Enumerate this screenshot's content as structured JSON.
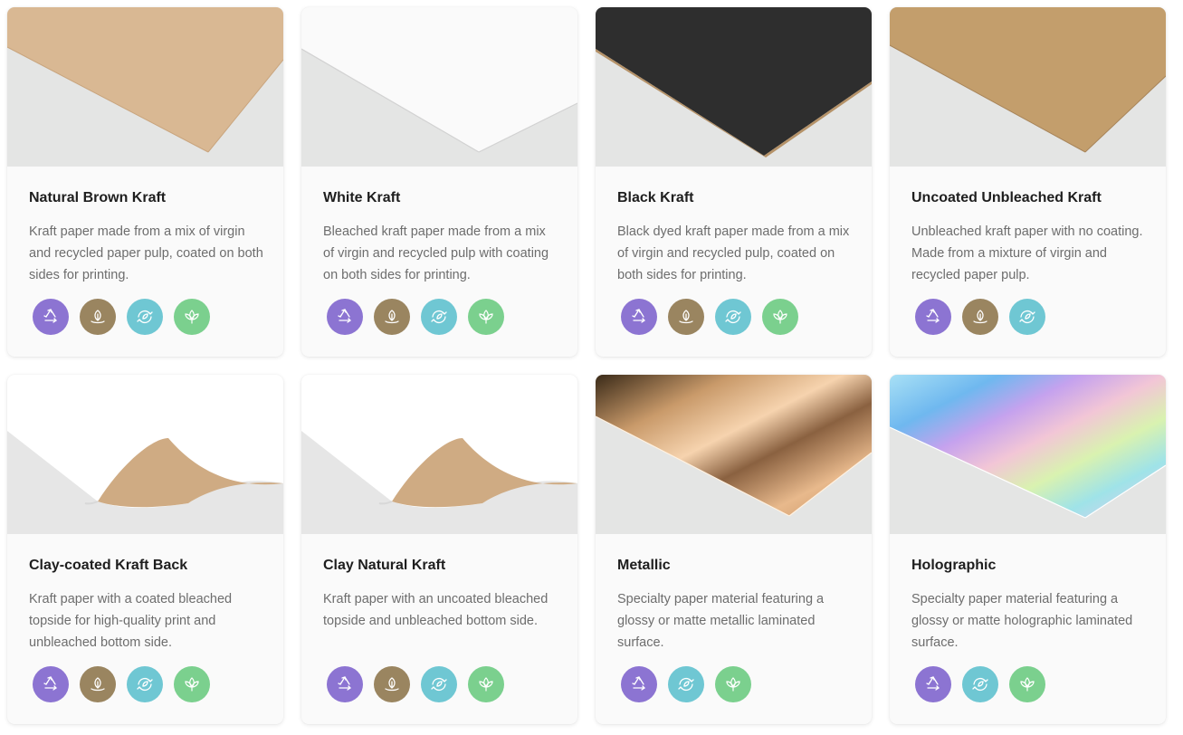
{
  "colors": {
    "recyclable": "#8c74d2",
    "biodegradable": "#9a8560",
    "recycled_content": "#6fc7d3",
    "plant_based": "#7bd08e"
  },
  "cards": [
    {
      "title": "Natural Brown Kraft",
      "description": "Kraft paper made from a mix of virgin and recycled paper pulp, coated on both sides for printing.",
      "image": "kraft-brown",
      "badges": [
        "recyclable-icon",
        "biodegradable-icon",
        "recycled-content-icon",
        "plant-based-icon"
      ]
    },
    {
      "title": "White Kraft",
      "description": "Bleached kraft paper made from a mix of virgin and recycled pulp with coating on both sides for printing.",
      "image": "kraft-white",
      "badges": [
        "recyclable-icon",
        "biodegradable-icon",
        "recycled-content-icon",
        "plant-based-icon"
      ]
    },
    {
      "title": "Black Kraft",
      "description": "Black dyed kraft paper made from a mix of virgin and recycled pulp, coated on both sides for printing.",
      "image": "kraft-black",
      "badges": [
        "recyclable-icon",
        "biodegradable-icon",
        "recycled-content-icon",
        "plant-based-icon"
      ]
    },
    {
      "title": "Uncoated Unbleached Kraft",
      "description": "Unbleached kraft paper with no coating. Made from a mixture of virgin and recycled paper pulp.",
      "image": "kraft-uncoated",
      "badges": [
        "recyclable-icon",
        "biodegradable-icon",
        "recycled-content-icon"
      ]
    },
    {
      "title": "Clay-coated Kraft Back",
      "description": "Kraft paper with a coated bleached topside for high-quality print and unbleached bottom side.",
      "image": "curl-kraft-back",
      "badges": [
        "recyclable-icon",
        "biodegradable-icon",
        "recycled-content-icon",
        "plant-based-icon"
      ]
    },
    {
      "title": "Clay Natural Kraft",
      "description": "Kraft paper with an uncoated bleached topside and unbleached bottom side.",
      "image": "curl-kraft-natural",
      "badges": [
        "recyclable-icon",
        "biodegradable-icon",
        "recycled-content-icon",
        "plant-based-icon"
      ]
    },
    {
      "title": "Metallic",
      "description": "Specialty paper material featuring a glossy or matte metallic laminated surface.",
      "image": "metallic",
      "badges": [
        "recyclable-icon",
        "recycled-content-icon",
        "plant-based-icon"
      ]
    },
    {
      "title": "Holographic",
      "description": "Specialty paper material featuring a glossy or matte holographic laminated surface.",
      "image": "holographic",
      "badges": [
        "recyclable-icon",
        "recycled-content-icon",
        "plant-based-icon"
      ]
    }
  ]
}
